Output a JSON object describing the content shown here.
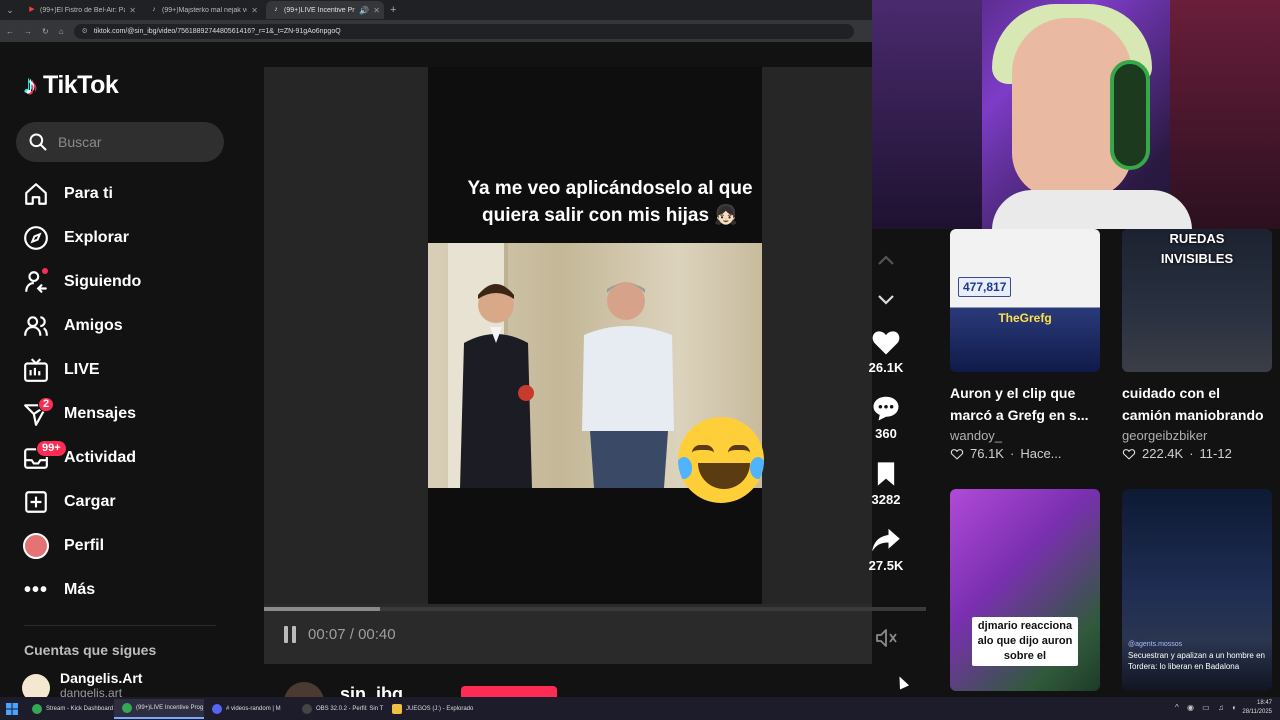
{
  "browser": {
    "tabs": [
      {
        "title": "(99+)El Fistro de Bel-Air: Parodi",
        "icon": "youtube-icon",
        "active": false
      },
      {
        "title": "(99+)Majsterko mal nejak vefa",
        "icon": "tiktok-icon",
        "active": false
      },
      {
        "title": "(99+)LIVE Incentive Progra",
        "icon": "tiktok-icon",
        "active": true
      }
    ],
    "url": "tiktok.com/@sin_ibg/video/7561889274480561416?_r=1&_t=ZN-91gAo6npgoQ"
  },
  "sidebar": {
    "logo_text": "TikTok",
    "search_placeholder": "Buscar",
    "items": [
      {
        "label": "Para ti",
        "icon": "home-icon"
      },
      {
        "label": "Explorar",
        "icon": "compass-icon"
      },
      {
        "label": "Siguiendo",
        "icon": "following-icon"
      },
      {
        "label": "Amigos",
        "icon": "friends-icon"
      },
      {
        "label": "LIVE",
        "icon": "live-icon"
      },
      {
        "label": "Mensajes",
        "icon": "send-icon",
        "badge": "2"
      },
      {
        "label": "Actividad",
        "icon": "inbox-icon",
        "badge": "99+"
      },
      {
        "label": "Cargar",
        "icon": "upload-icon"
      },
      {
        "label": "Perfil",
        "icon": "profile-avatar"
      },
      {
        "label": "Más",
        "icon": "more-icon"
      }
    ],
    "following_title": "Cuentas que sigues",
    "following": [
      {
        "name": "Dangelis.Art",
        "handle": "dangelis.art"
      }
    ]
  },
  "video": {
    "caption": "Ya me veo  aplicándoselo al que quiera salir con mis hijas 👧🏻",
    "current_time": "00:07",
    "duration": "00:40",
    "time_separator": " / ",
    "progress": 0.175,
    "author": "sin_ibg"
  },
  "actions": [
    {
      "name": "like",
      "icon": "heart-icon",
      "count": "26.1K"
    },
    {
      "name": "comment",
      "icon": "comment-icon",
      "count": "360"
    },
    {
      "name": "save",
      "icon": "bookmark-icon",
      "count": "3282"
    },
    {
      "name": "share",
      "icon": "share-icon",
      "count": "27.5K"
    }
  ],
  "grid": [
    {
      "title": "Auron y el clip que marcó a Grefg en s...",
      "author": "wandoy_",
      "likes": "76.1K",
      "date": "Hace...",
      "thumb_text": "TheGrefg",
      "thumb_badge": "477,817"
    },
    {
      "title": "cuidado con el camión maniobrando",
      "author": "georgeibzbiker",
      "likes": "222.4K",
      "date": "11-12",
      "thumb_text": "RUEDAS INVISIBLES"
    },
    {
      "title": "",
      "author": "",
      "likes": "",
      "date": "",
      "thumb_text": "djmario reacciona alo que dijo auron sobre el"
    },
    {
      "title": "",
      "author": "",
      "likes": "",
      "date": "",
      "thumb_text": "Secuestran y apalizan a un hombre en Tordera: lo liberan en Badalona",
      "thumb_badge": "@agents.mossos"
    }
  ],
  "taskbar": {
    "items": [
      {
        "label": "Stream - Kick Dashboard",
        "color": "#34a853"
      },
      {
        "label": "(99+)LIVE Incentive Prog",
        "color": "#34a853",
        "active": true
      },
      {
        "label": "# videos-random | M",
        "color": "#5865f2"
      },
      {
        "label": "OBS 32.0.2 - Perfil: Sin T",
        "color": "#444444"
      },
      {
        "label": "JUEGOS (J:) - Explorado",
        "color": "#f0c040"
      }
    ],
    "time": "18:47",
    "date": "28/11/2025"
  },
  "colors": {
    "accent": "#fe2c55",
    "bg": "#121212"
  }
}
